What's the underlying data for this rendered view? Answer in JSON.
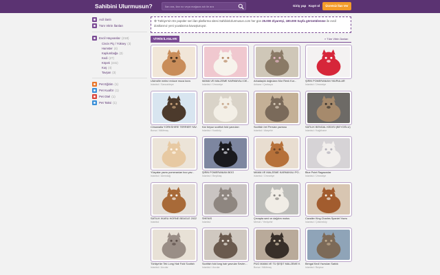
{
  "header": {
    "logo": "Sahibini Ulurmusun?",
    "search_placeholder": "İlan ara, ilan no veya mağaza adı ile ara",
    "login": "Giriş yap",
    "register": "Kayıt ol",
    "free_ad": "Ücretsiz İlan Ver"
  },
  "sidebar": {
    "top": [
      {
        "label": "Acil ilanlı",
        "color": "#7a4a94"
      },
      {
        "label": "Tüm Vitrin İlanları",
        "color": "#7a4a94"
      }
    ],
    "category": {
      "label": "Evcil Hayvanlar",
      "count": "(218)",
      "color": "#7a4a94"
    },
    "subs": [
      {
        "label": "Civciv Piç / Yüksey",
        "count": "(3)"
      },
      {
        "label": "Hamster",
        "count": "(4)"
      },
      {
        "label": "Kaplumbağa",
        "count": "(3)"
      },
      {
        "label": "Kedi",
        "count": "(27)"
      },
      {
        "label": "Köpek",
        "count": "(441)"
      },
      {
        "label": "Kuş",
        "count": "(4)"
      },
      {
        "label": "Tavşan",
        "count": "(3)"
      }
    ],
    "extra": [
      {
        "label": "Pet Eğitim",
        "count": "(1)",
        "color": "#e8762b"
      },
      {
        "label": "Pet Kuaför",
        "count": "(1)",
        "color": "#3a8fd8"
      },
      {
        "label": "Pet Otel",
        "count": "(1)",
        "color": "#d9443a"
      },
      {
        "label": "Pet Taksi",
        "count": "(1)",
        "color": "#3a8fd8"
      }
    ]
  },
  "notice": {
    "part1": "Türkiye'nin En popüler seri ilan platforma sitesi SahibiniUlurmusun.com her gün",
    "bold1": "25.000 Ziyaretçi, 180.000 Sayfa görüntülenme",
    "part2": "ile evcil dostlarınız yeni yuvalarına kavuşturuyor."
  },
  "section": {
    "tab": "VİTRİN İLANLARI",
    "link": "Tüm Vitrin İlanları"
  },
  "cards": [
    {
      "title": "Ulcinville melez reduce muca kuvs",
      "loc": "İstanbul / Sancaktepe",
      "colors": [
        "#f1e6d8",
        "#c98d5a",
        "#3a2a1a"
      ]
    },
    {
      "title": "MAMA VE MALZEME KARMAYALI DE...",
      "loc": "İstanbul / Ümraniye",
      "colors": [
        "#f0c8cf",
        "#f7f3ec",
        "#b68863"
      ]
    },
    {
      "title": "Arkadaşlık doğrulanı Mor Renk Kur...",
      "loc": "Ankara / Çankaya",
      "colors": [
        "#cfc7b8",
        "#8a7a66",
        "#e8b9c9"
      ]
    },
    {
      "title": "ŞİRİN POMERANIAN YAVRULAR",
      "loc": "İstanbul / Ümraniye",
      "colors": [
        "#f4f2f2",
        "#d6263a",
        "#ffffff"
      ]
    },
    {
      "title": "Cinsanatla YORKSHIRE TERRIER YAV...",
      "loc": "Bursa / Nilüferaş",
      "colors": [
        "#d8e5f0",
        "#4c3a2c",
        "#c9a27b"
      ]
    },
    {
      "title": "Kar beyaz scottish fold yavruları",
      "loc": "İstanbul / Kadıköy",
      "colors": [
        "#d9d3c8",
        "#f3efe6",
        "#c8a98e"
      ]
    },
    {
      "title": "Scottish Irel Persian yavrusu",
      "loc": "İstanbul / Ataşehir",
      "colors": [
        "#c4b096",
        "#7a6a5a",
        "#d8cbb8"
      ]
    },
    {
      "title": "SATILIK BENGAL KEDİSİ (BEYOĞLU)",
      "loc": "İstanbul / Kağıthane",
      "colors": [
        "#6d6a66",
        "#a68a6c",
        "#3a342e"
      ]
    },
    {
      "title": "Yüzyalar yavru pomeranian boo yav...",
      "loc": "İstanbul / Alemdağ",
      "colors": [
        "#ece4d8",
        "#e7c9a2",
        "#fff6ea"
      ]
    },
    {
      "title": "ŞİRİN POMERANIAN BOO",
      "loc": "İstanbul / Beşiktaş",
      "colors": [
        "#7d86a0",
        "#1a1a1e",
        "#d5d7de"
      ]
    },
    {
      "title": "MAMA VE MALZEME KARMAYALI PO...",
      "loc": "İstanbul / Ümraniye",
      "colors": [
        "#e8ddd0",
        "#b6713a",
        "#6a4326"
      ]
    },
    {
      "title": "Blue Point Ragazzolar",
      "loc": "İstanbul / Ümraniye",
      "colors": [
        "#d6d3d6",
        "#f2efed",
        "#b4b1bb"
      ]
    },
    {
      "title": "SATILIK IKARU HORNE BEAGLE 2022",
      "loc": "İstanbul",
      "colors": [
        "#e4ded6",
        "#a86a38",
        "#f6f2ec"
      ]
    },
    {
      "title": "SHENIS",
      "loc": "İstanbul",
      "colors": [
        "#c9c4c2",
        "#8e8680",
        "#e6e0dd"
      ]
    },
    {
      "title": "Çevapta seni ve dağılım motos",
      "loc": "Mersin / Yenişehir",
      "colors": [
        "#bdbdb9",
        "#f1ede6",
        "#8a8783"
      ]
    },
    {
      "title": "Cavalier King Charles Spaniel Yavru",
      "loc": "İstanbul / Çekmeköy",
      "colors": [
        "#d8c6b2",
        "#a25c2e",
        "#f3eee6"
      ]
    },
    {
      "title": "Türkiye'de Tek Long Hair Fold Scotish",
      "loc": "İstanbul / Avcılar",
      "colors": [
        "#e8e1d6",
        "#9a8e86",
        "#5b4e48"
      ]
    },
    {
      "title": "Scottish fold long hair yavrular Sevim...",
      "loc": "İstanbul / Avcılar",
      "colors": [
        "#cfc8c0",
        "#6a5a4e",
        "#ede6dc"
      ]
    },
    {
      "title": "PUG MAMA VE TÜ ŞEŞİT MALZEME K...",
      "loc": "Bursa / Nilüferaş",
      "colors": [
        "#b9aa9a",
        "#382f29",
        "#d6c5ad"
      ]
    },
    {
      "title": "Bengal Kedi Yavruları Satılık",
      "loc": "İstanbul / Beykoz",
      "colors": [
        "#8fa4b8",
        "#7c6a58",
        "#c2ad90"
      ]
    }
  ]
}
